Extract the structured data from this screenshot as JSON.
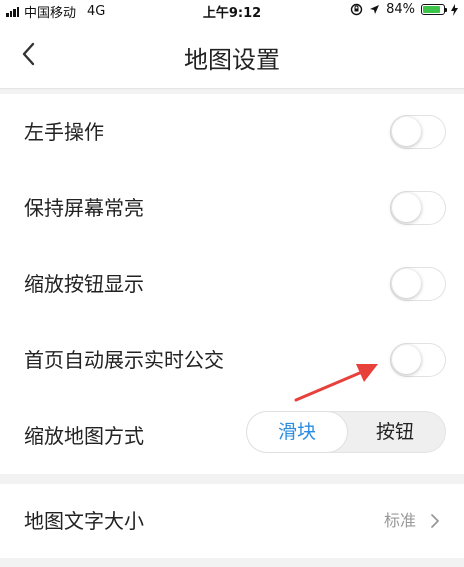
{
  "status_bar": {
    "carrier": "中国移动",
    "network": "4G",
    "time": "上午9:12",
    "battery_percent": "84%",
    "battery_level": 0.84
  },
  "nav": {
    "back_icon": "chevron-left-icon",
    "title": "地图设置"
  },
  "settings": [
    {
      "label": "左手操作",
      "enabled": false
    },
    {
      "label": "保持屏幕常亮",
      "enabled": false
    },
    {
      "label": "缩放按钮显示",
      "enabled": false
    },
    {
      "label": "首页自动展示实时公交",
      "enabled": false
    }
  ],
  "zoom_mode": {
    "label": "缩放地图方式",
    "options": [
      "滑块",
      "按钮"
    ],
    "selected": "滑块"
  },
  "font_size": {
    "label": "地图文字大小",
    "value": "标准"
  },
  "colors": {
    "accent": "#2c8ce0",
    "annotation_arrow": "#e8403a",
    "battery": "#3dc24a"
  }
}
